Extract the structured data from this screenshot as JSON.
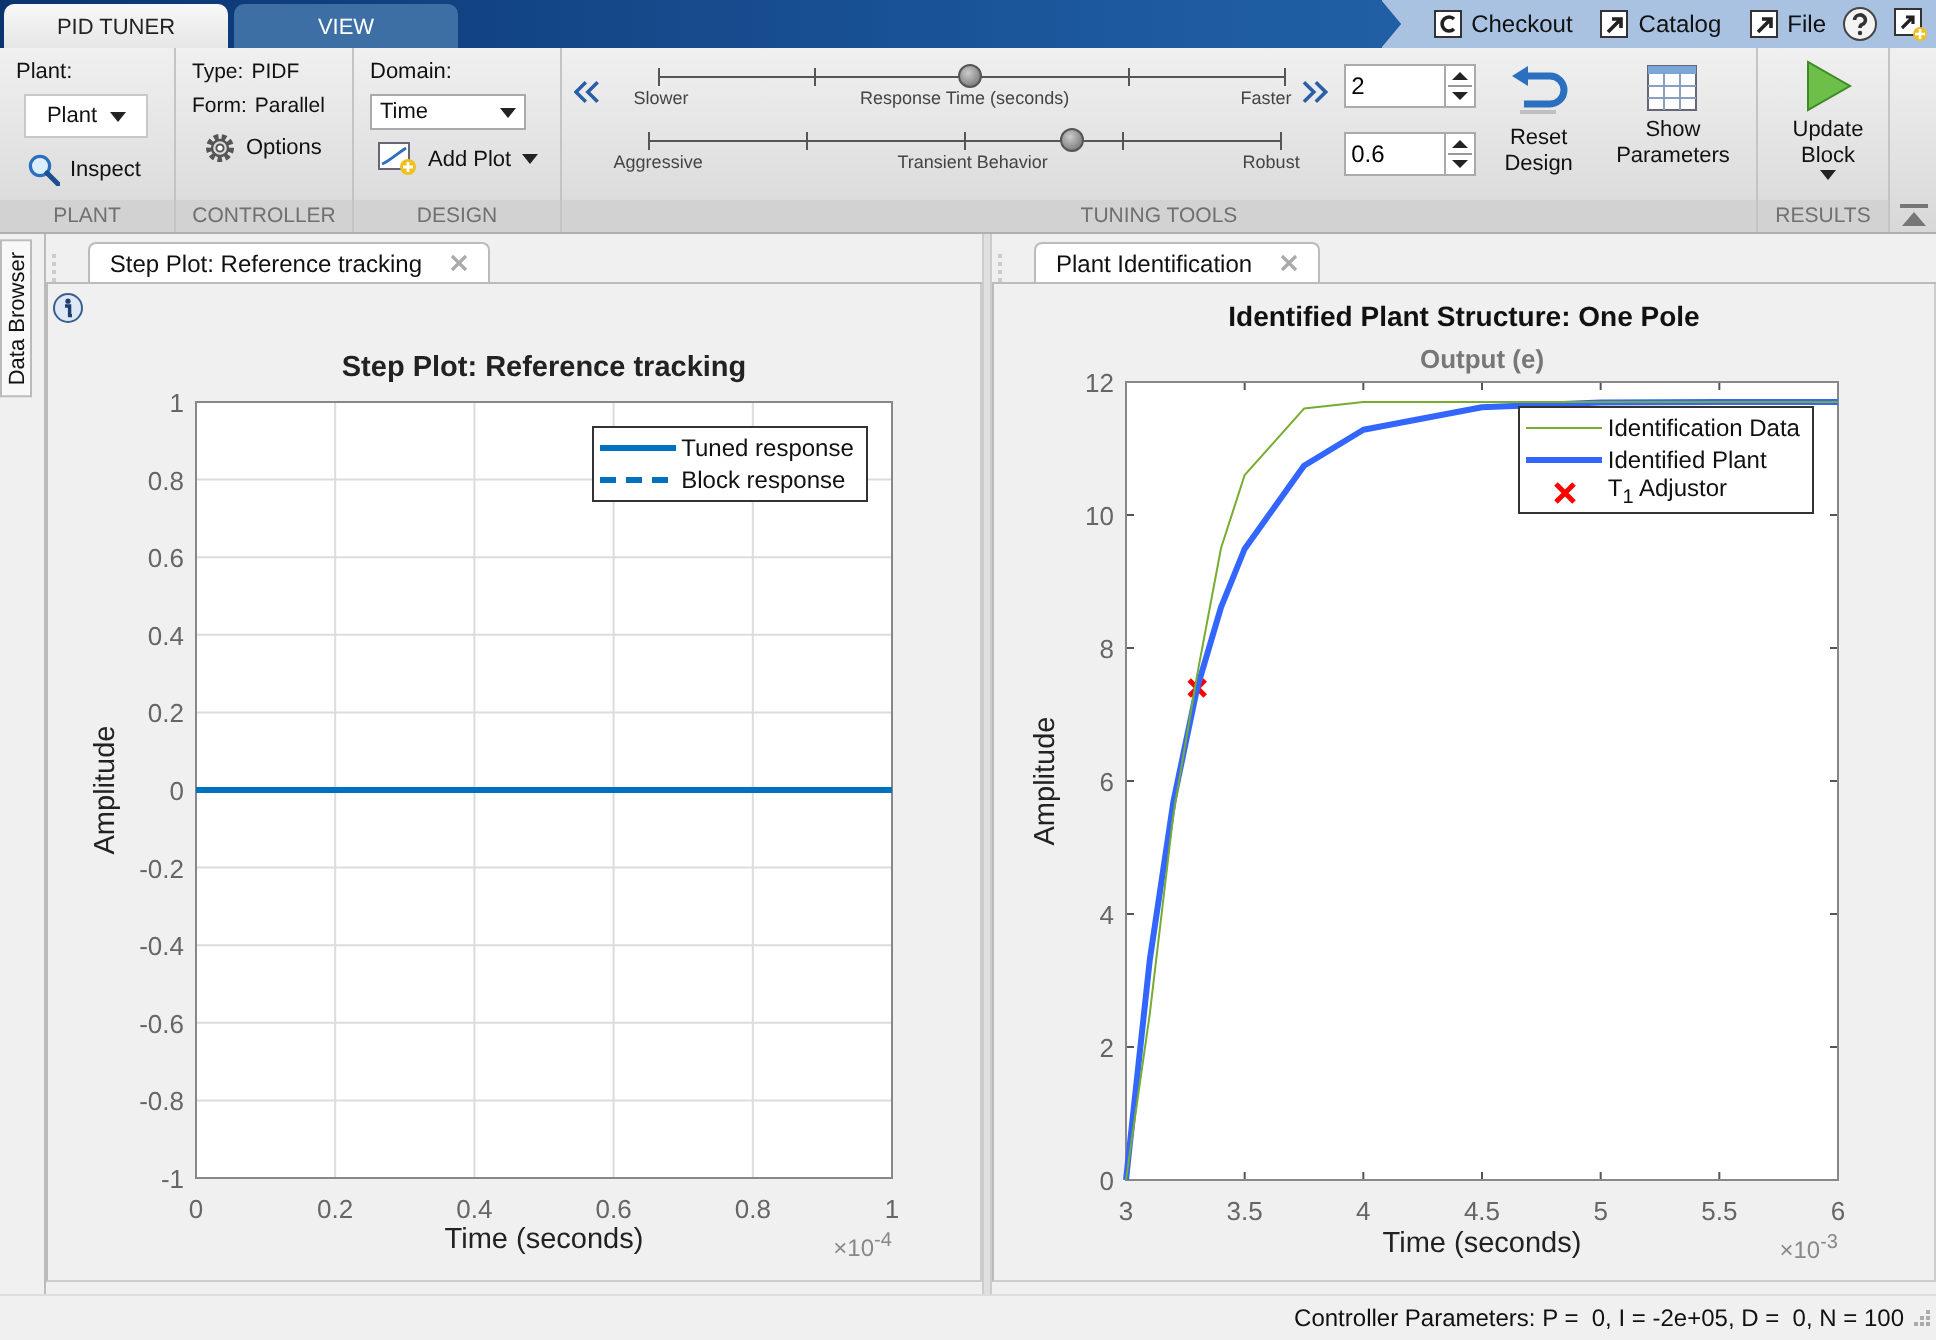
{
  "toolstrip_tabs": [
    {
      "label": "PID TUNER",
      "selected": true
    },
    {
      "label": "VIEW",
      "selected": false
    }
  ],
  "quick_access": [
    {
      "label": "Checkout",
      "kind": "letter"
    },
    {
      "label": "Catalog",
      "kind": "shortcut"
    },
    {
      "label": "File",
      "kind": "shortcut"
    }
  ],
  "ribbon": {
    "plant": {
      "heading": "Plant:",
      "dropdown": "Plant",
      "inspect": "Inspect",
      "section": "PLANT"
    },
    "controller": {
      "type_label": "Type:",
      "type": "PIDF",
      "form_label": "Form:",
      "form": "Parallel",
      "options": "Options",
      "section": "CONTROLLER"
    },
    "design": {
      "domain_label": "Domain:",
      "domain": "Time",
      "add_plot": "Add Plot",
      "section": "DESIGN"
    },
    "tuning": {
      "sliders": [
        {
          "left": "Slower",
          "center": "Response Time (seconds)",
          "right": "Faster",
          "level": 0.5,
          "value": "2"
        },
        {
          "left": "Aggressive",
          "center": "Transient Behavior",
          "right": "Robust",
          "level": 0.67,
          "value": "0.6"
        }
      ],
      "reset": "Reset Design",
      "show_parameters": "Show Parameters",
      "section": "TUNING TOOLS"
    },
    "results": {
      "update": "Update Block",
      "section": "RESULTS"
    }
  },
  "side_tab": "Data Browser",
  "left_panel": {
    "tab": {
      "label": "Step Plot: Reference tracking",
      "selected": true
    },
    "chart_data": {
      "type": "line",
      "title": "Step Plot: Reference tracking",
      "xlabel": "Time (seconds)",
      "ylabel": "Amplitude",
      "x": [
        0,
        1
      ],
      "xlim": [
        0,
        1
      ],
      "ylim": [
        -1,
        1
      ],
      "xticks": [
        0,
        0.2,
        0.4,
        0.6,
        0.8,
        1
      ],
      "yticks": [
        -1,
        -0.8,
        -0.6,
        -0.4,
        -0.2,
        0,
        0.2,
        0.4,
        0.6,
        0.8,
        1
      ],
      "grid": true,
      "annotations": [
        "×10$^{-4}$"
      ],
      "legend": "upper right",
      "series": [
        {
          "name": "Tuned response",
          "color": "#0072bd",
          "line_style": "solid",
          "values": [
            0,
            0
          ]
        },
        {
          "name": "Block response",
          "color": "#0072bd",
          "line_style": "dashed",
          "values": [
            null,
            null
          ]
        }
      ]
    }
  },
  "right_panel": {
    "tab": {
      "label": "Plant Identification",
      "selected": true
    },
    "heading": "Identified Plant Structure: One Pole",
    "chart_data": {
      "type": "line",
      "title": "Output (e)",
      "xlabel": "Time (seconds)",
      "ylabel": "Amplitude",
      "x": [
        3,
        3.1,
        3.2,
        3.3,
        3.4,
        3.5,
        3.75,
        4,
        4.5,
        5,
        5.5,
        6
      ],
      "xlim": [
        3,
        6
      ],
      "ylim": [
        0,
        12
      ],
      "xticks": [
        3,
        3.5,
        4,
        4.5,
        5,
        5.5,
        6
      ],
      "yticks": [
        0,
        2,
        4,
        6,
        8,
        10,
        12
      ],
      "grid": false,
      "annotations": [
        "×10$^{-3}$"
      ],
      "legend": "upper right",
      "series": [
        {
          "name": "Identification Data",
          "color": "#77ac30",
          "line_style": "solid",
          "values": [
            0,
            2.5,
            5.5,
            7.6,
            9.5,
            10.6,
            11.6,
            11.7,
            11.7,
            11.7,
            11.7,
            11.7
          ]
        },
        {
          "name": "Identified Plant",
          "color": "#3366ff",
          "line_style": "solid",
          "values": [
            0,
            3.31,
            5.69,
            7.4,
            8.61,
            9.49,
            10.74,
            11.28,
            11.62,
            11.69,
            11.7,
            11.7
          ]
        },
        {
          "name": "T$_{1}$ Adjustor",
          "color": "#ff0000",
          "line_style": "none",
          "marker": "x",
          "values": [
            null,
            null,
            null,
            7.4,
            null,
            null,
            null,
            null,
            null,
            null,
            null,
            null
          ]
        }
      ]
    }
  },
  "status_bar": "Controller Parameters: P =  0, I = -2e+05, D =  0, N = 100"
}
